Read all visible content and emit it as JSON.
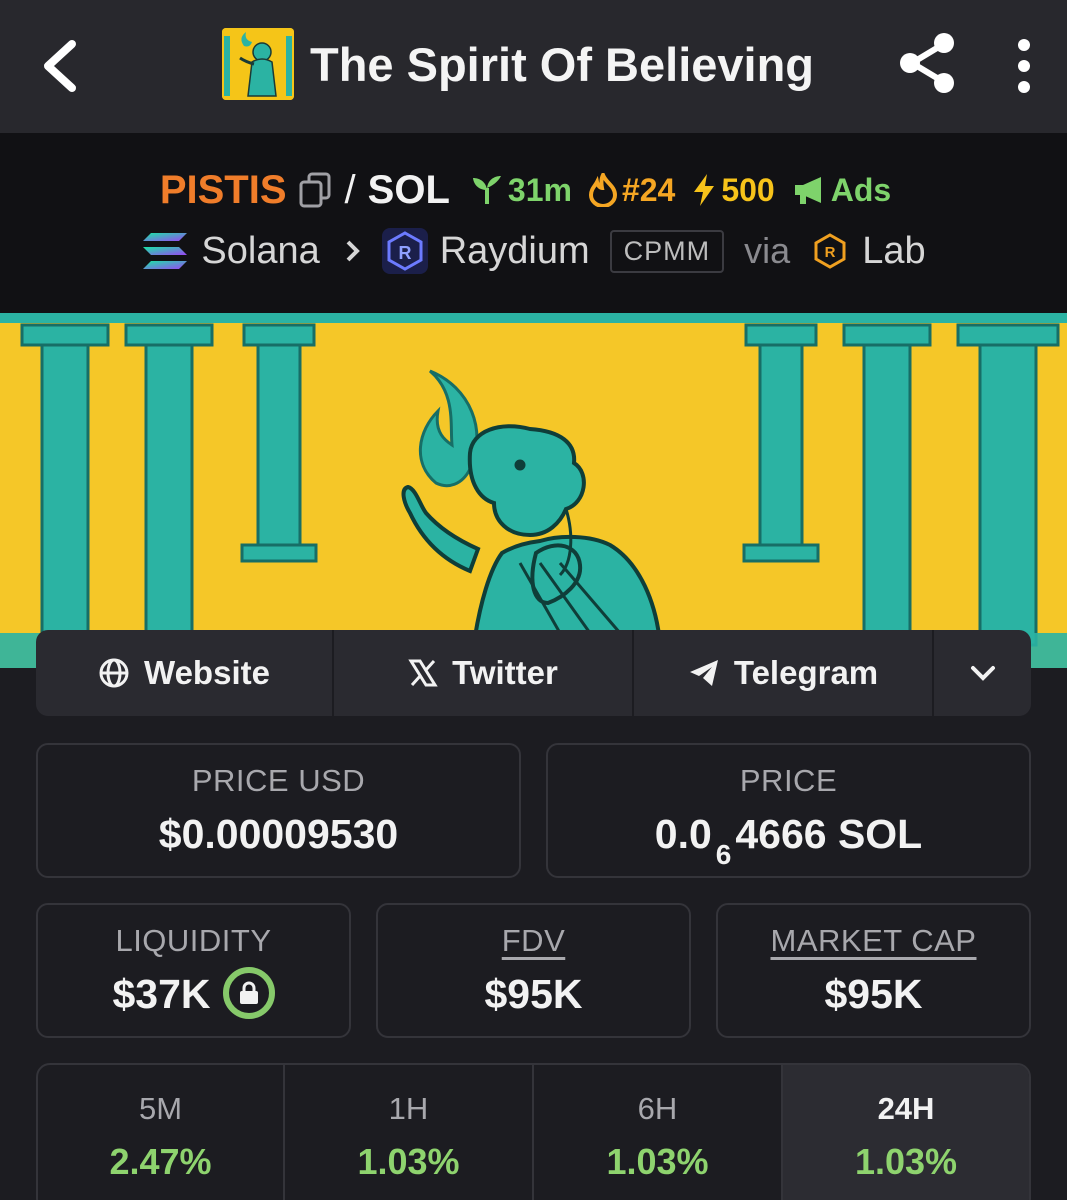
{
  "header": {
    "title": "The Spirit Of Believing",
    "back_icon": "chevron-left-icon",
    "share_icon": "share-icon",
    "more_icon": "more-vertical-icon"
  },
  "pair": {
    "base": "PISTIS",
    "separator": "/",
    "quote": "SOL",
    "age": "31m",
    "trending_rank": "#24",
    "boosts": "500",
    "ads_label": "Ads",
    "chain": "Solana",
    "dex": "Raydium",
    "pool_type": "CPMM",
    "via_label": "via",
    "launchpad": "Lab"
  },
  "links": {
    "website": "Website",
    "twitter": "Twitter",
    "telegram": "Telegram"
  },
  "stats": {
    "price_usd_label": "PRICE USD",
    "price_usd": "$0.00009530",
    "price_label": "PRICE",
    "price_prefix": "0.0",
    "price_zeros": "6",
    "price_suffix": "4666 SOL",
    "liquidity_label": "LIQUIDITY",
    "liquidity": "$37K",
    "fdv_label": "FDV",
    "fdv": "$95K",
    "mcap_label": "MARKET CAP",
    "mcap": "$95K"
  },
  "timeframes": [
    {
      "label": "5M",
      "change": "2.47%"
    },
    {
      "label": "1H",
      "change": "1.03%"
    },
    {
      "label": "6H",
      "change": "1.03%"
    },
    {
      "label": "24H",
      "change": "1.03%",
      "active": true
    }
  ],
  "colors": {
    "accent_orange": "#f07d2a",
    "positive_green": "#8ed36e",
    "banner_yellow": "#f5c728",
    "statue_teal": "#2bb3a3"
  }
}
